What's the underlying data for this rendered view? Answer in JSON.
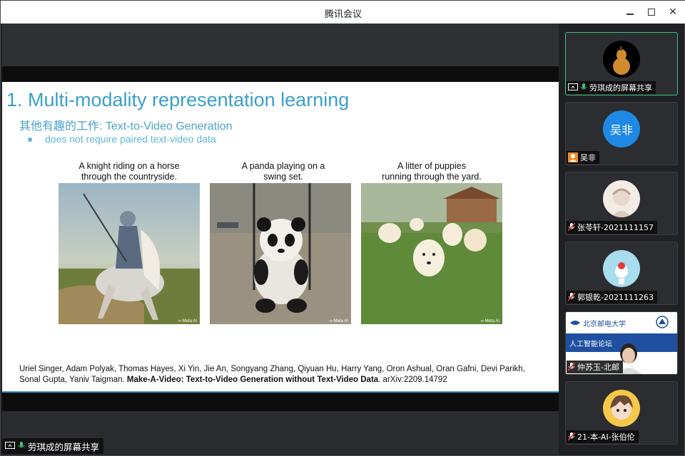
{
  "window": {
    "title": "腾讯会议"
  },
  "slide": {
    "title": "1.  Multi-modality representation learning",
    "subtitle": "其他有趣的工作: Text-to-Video Generation",
    "bullet": "does not require paired text-video data",
    "examples": [
      {
        "caption_line1": "A knight riding on a horse",
        "caption_line2": "through the countryside.",
        "watermark": "∞ Meta AI"
      },
      {
        "caption_line1": "A panda playing on a",
        "caption_line2": "swing set.",
        "watermark": "∞ Meta AI"
      },
      {
        "caption_line1": "A litter of puppies",
        "caption_line2": "running through the yard.",
        "watermark": "∞ Meta AI"
      }
    ],
    "citation_authors": "Uriel Singer, Adam Polyak, Thomas Hayes, Xi Yin, Jie An, Songyang Zhang, Qiyuan Hu, Harry Yang, Oron Ashual, Oran Gafni, Devi Parikh, Sonal Gupta, Yaniv Taigman.",
    "citation_title": "Make-A-Video: Text-to-Video Generation without Text-Video Data",
    "citation_suffix": ". arXiv:2209.14792"
  },
  "share_label": "劳琪成的屏幕共享",
  "participants": [
    {
      "name": "劳琪成的屏幕共享",
      "icon": "screen-share-icon",
      "mic": "on",
      "avatar": "gourd-avatar"
    },
    {
      "name": "吴非",
      "icon": "user-icon",
      "mic": "none",
      "avatar_text": "吴非"
    },
    {
      "name": "张苓轩-2021111157",
      "icon": "mic-muted-icon",
      "mic": "muted",
      "avatar": "sketch-avatar"
    },
    {
      "name": "郭银乾-2021111263",
      "icon": "mic-muted-icon",
      "mic": "muted",
      "avatar": "cartoon-avatar"
    },
    {
      "name": "仲苏玉-北邮",
      "icon": "mic-muted-icon",
      "mic": "muted",
      "video_banner": "人工智能论坛",
      "video_logo": "北京邮电大学"
    },
    {
      "name": "21-本-AI-张伯伦",
      "icon": "mic-muted-icon",
      "mic": "muted",
      "avatar": "anime-avatar"
    }
  ],
  "colors": {
    "accent_blue": "#3a9fc8",
    "active_border": "#3cc27a",
    "muted_red": "#e53935",
    "mic_green": "#3cc27a"
  }
}
